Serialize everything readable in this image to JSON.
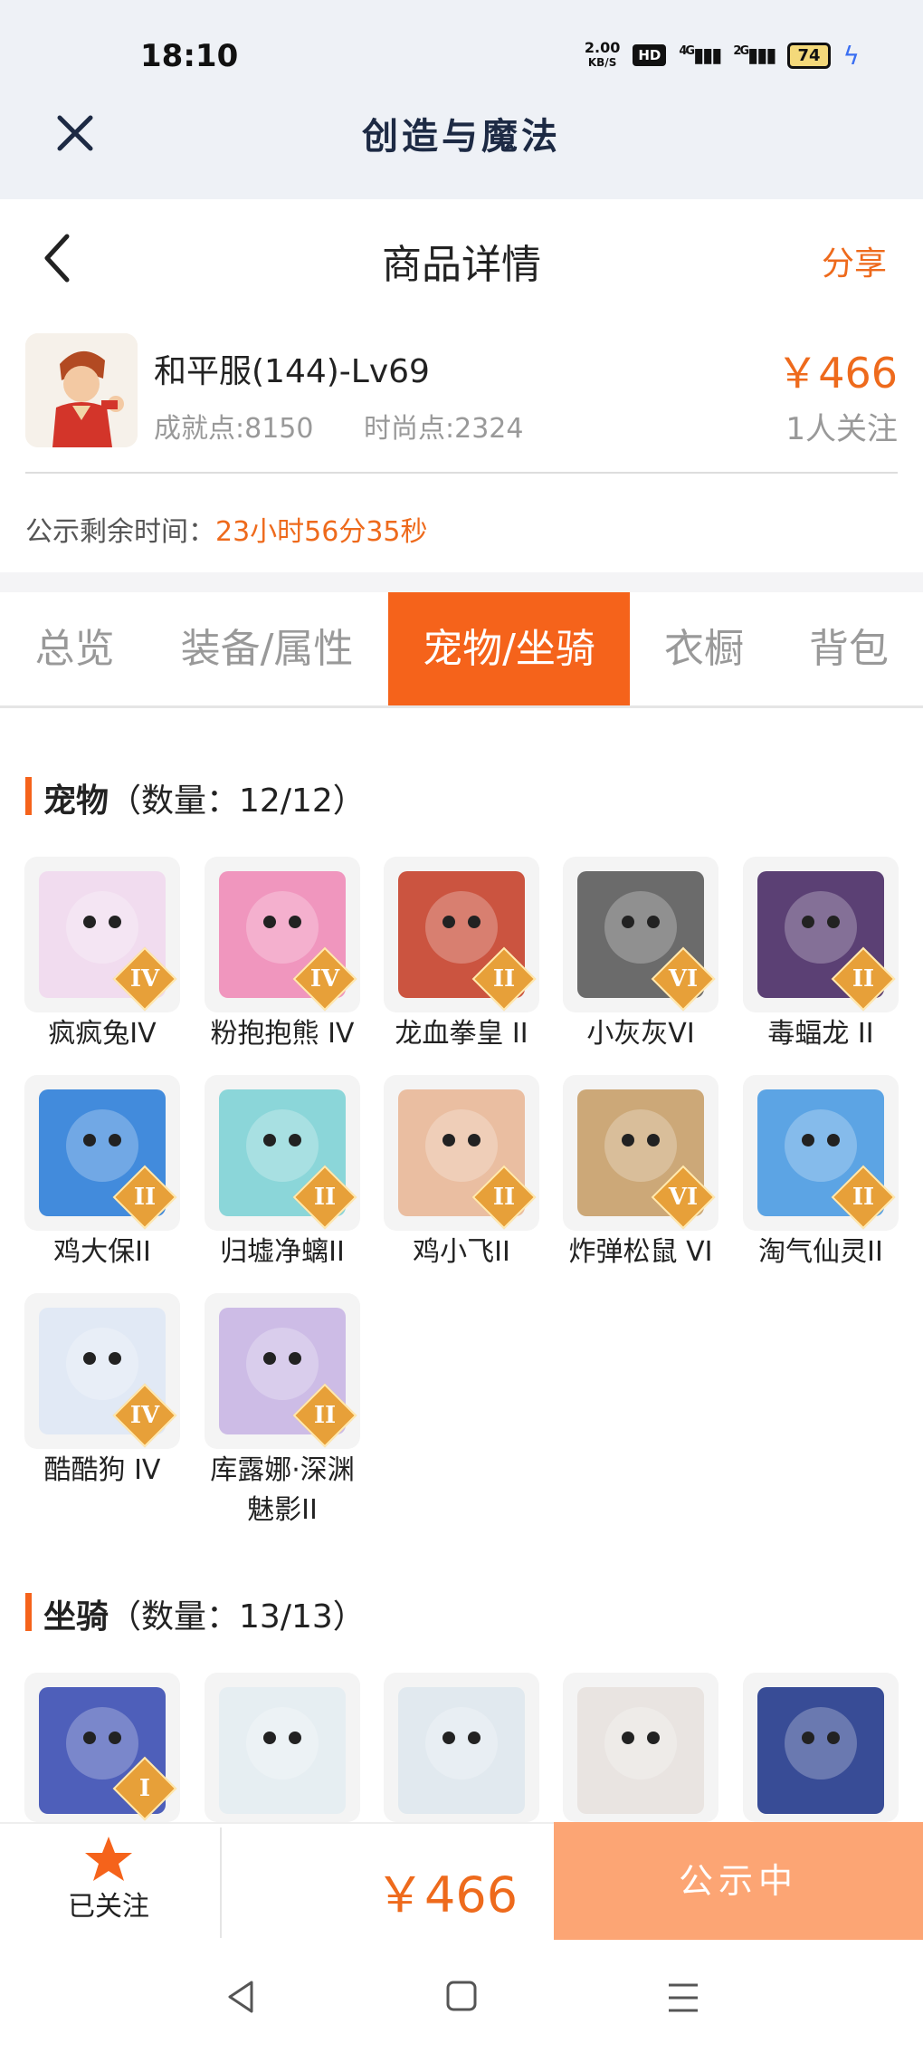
{
  "status": {
    "time": "18:10",
    "net_speed_top": "2.00",
    "net_speed_unit": "KB/S",
    "hd": "HD",
    "signal1": "4G",
    "signal2": "2G",
    "battery": "74"
  },
  "app": {
    "title": "创造与魔法"
  },
  "nav": {
    "title": "商品详情",
    "share": "分享"
  },
  "product": {
    "name": "和平服(144)-Lv69",
    "achievement": "成就点:8150",
    "fashion": "时尚点:2324",
    "price": "￥466",
    "followers": "1人关注"
  },
  "notice": {
    "label": "公示剩余时间：",
    "countdown": "23小时56分35秒"
  },
  "tabs": [
    {
      "label": "总览"
    },
    {
      "label": "装备/属性"
    },
    {
      "label": "宠物/坐骑",
      "active": true
    },
    {
      "label": "衣橱"
    },
    {
      "label": "背包"
    }
  ],
  "pets": {
    "title": "宠物",
    "count": "（数量：12/12）",
    "items": [
      {
        "label": "疯疯兔IV",
        "badge": "IV",
        "color": "#f1d9ee"
      },
      {
        "label": "粉抱抱熊 IV",
        "badge": "IV",
        "color": "#f08cb8"
      },
      {
        "label": "龙血拳皇 II",
        "badge": "II",
        "color": "#c7432c"
      },
      {
        "label": "小灰灰VI",
        "badge": "VI",
        "color": "#5c5c5c"
      },
      {
        "label": "毒蝠龙 II",
        "badge": "II",
        "color": "#4a2c66"
      },
      {
        "label": "鸡大保II",
        "badge": "II",
        "color": "#2f7fd9"
      },
      {
        "label": "归墟净螭II",
        "badge": "II",
        "color": "#7fd3d6"
      },
      {
        "label": "鸡小飞II",
        "badge": "II",
        "color": "#e9b898"
      },
      {
        "label": "炸弹松鼠 VI",
        "badge": "VI",
        "color": "#c8a06a"
      },
      {
        "label": "淘气仙灵II",
        "badge": "II",
        "color": "#4b9be2"
      },
      {
        "label": "酷酷狗 IV",
        "badge": "IV",
        "color": "#dfe8f5"
      },
      {
        "label": "库露娜·深渊魅影II",
        "badge": "II",
        "color": "#c9b6e4"
      }
    ]
  },
  "mounts": {
    "title": "坐骑",
    "count": "（数量：13/13）",
    "items": [
      {
        "badge": "I",
        "color": "#3c4fb4"
      },
      {
        "color": "#e4edf2"
      },
      {
        "color": "#dfe8ee"
      },
      {
        "color": "#e8e2df"
      },
      {
        "color": "#233a8c"
      }
    ]
  },
  "bottom": {
    "follow_label": "已关注",
    "price": "￥466",
    "status_button": "公示中"
  },
  "colors": {
    "accent": "#f5631b",
    "price": "#ee6a1c",
    "button_bg": "#fca574"
  }
}
